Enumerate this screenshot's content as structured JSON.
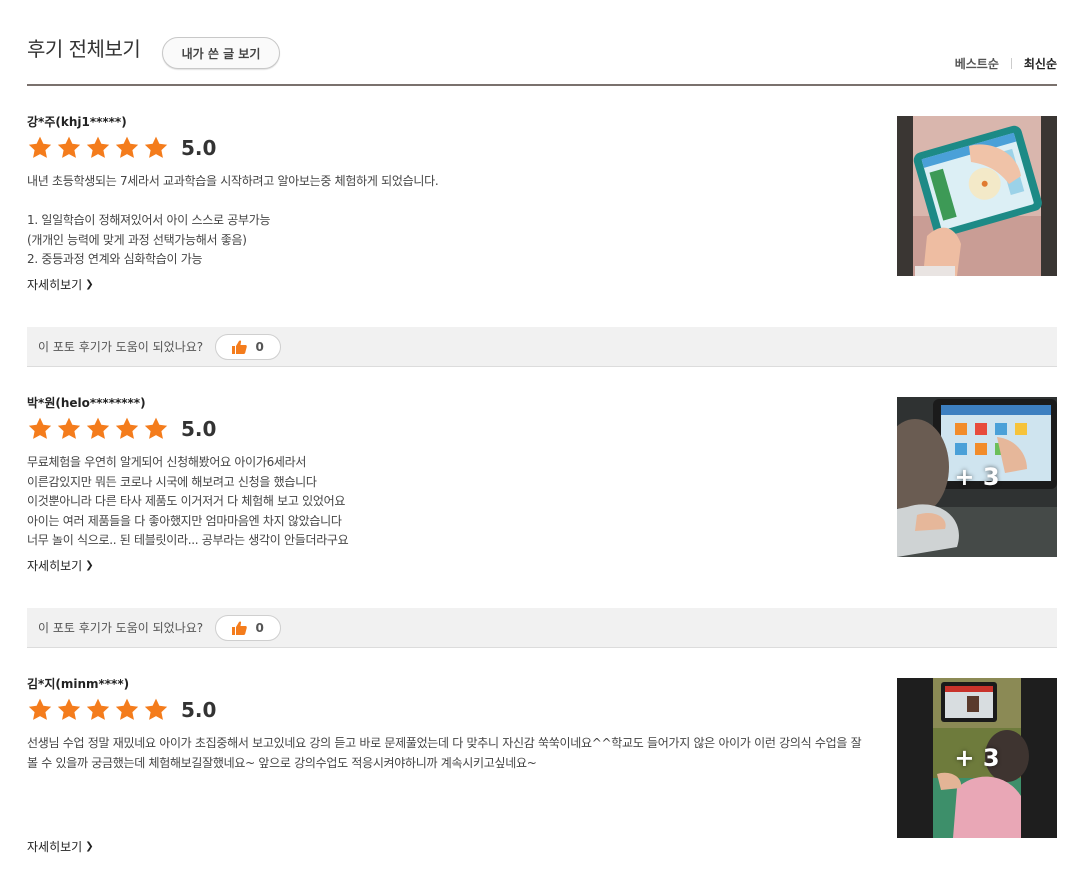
{
  "header": {
    "title": "후기 전체보기",
    "my_reviews_label": "내가 쓴 글 보기",
    "sort_best": "베스트순",
    "sort_latest": "최신순"
  },
  "colors": {
    "star": "#f47c1c",
    "accent": "#f47c1c",
    "divider": "#7a716d"
  },
  "reviews": [
    {
      "reviewer": "강*주(khj1*****)",
      "score": "5.0",
      "stars": 5,
      "lines": [
        "내년 초등학생되는 7세라서 교과학습을 시작하려고 알아보는중 체험하게 되었습니다.",
        "",
        "1. 일일학습이 정해져있어서 아이 스스로 공부가능",
        "(개개인 능력에 맞게 과정 선택가능해서 좋음)",
        "2. 중등과정 연계와 심화학습이 가능"
      ],
      "more_label": "자세히보기",
      "photo_count": "",
      "helpful_question": "이 포토 후기가 도움이 되었나요?",
      "like_count": "0"
    },
    {
      "reviewer": "박*원(helo********)",
      "score": "5.0",
      "stars": 5,
      "lines": [
        "무료체험을 우연히 알게되어 신청해봤어요 아이가6세라서",
        "이른감있지만 뭐든 코로나 시국에 해보려고 신청을 했습니다",
        "이것뿐아니라 다른 타사 제품도 이거저거 다 체험해 보고 있었어요",
        "아이는 여러 제품들을 다 좋아했지만 엄마마음엔 차지 않았습니다",
        "너무 놀이 식으로.. 된 테블릿이라... 공부라는 생각이 안들더라구요"
      ],
      "more_label": "자세히보기",
      "photo_count": "+ 3",
      "helpful_question": "이 포토 후기가 도움이 되었나요?",
      "like_count": "0"
    },
    {
      "reviewer": "김*지(minm****)",
      "score": "5.0",
      "stars": 5,
      "lines": [
        "선생님 수업 정말 재밌네요 아이가 초집중해서 보고있네요 강의 듣고 바로 문제풀었는데 다 맞추니 자신감 쑥쑥이네요^^학교도 들어가지 않은 아이가 이런 강의식 수업을 잘 볼 수 있을까 궁금했는데 체험해보길잘했네요~ 앞으로 강의수업도 적응시켜야하니까 계속시키고싶네요~"
      ],
      "more_label": "자세히보기",
      "photo_count": "+ 3",
      "helpful_question": "",
      "like_count": ""
    }
  ]
}
